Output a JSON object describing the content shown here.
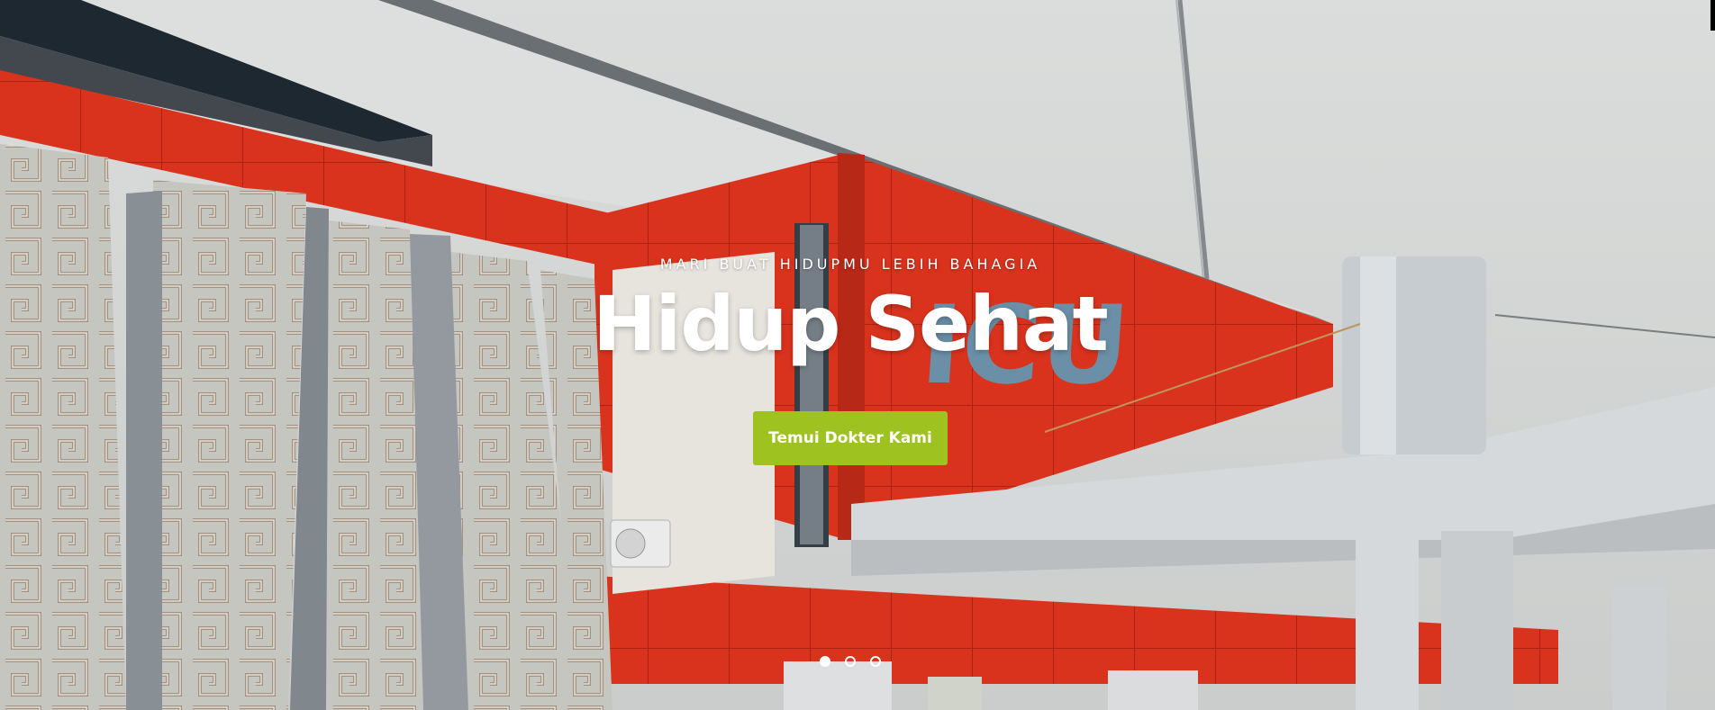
{
  "hero": {
    "eyebrow": "MARI BUAT HIDUPMU LEBIH BAHAGIA",
    "headline": "Hidup Sehat",
    "cta_label": "Temui Dokter Kami",
    "building_sign": "ICU",
    "slides": {
      "count": 3,
      "active_index": 0
    }
  },
  "colors": {
    "accent": "#9ec21f",
    "building_red": "#e8321e",
    "sky": "#dcdedd",
    "text": "#ffffff"
  }
}
